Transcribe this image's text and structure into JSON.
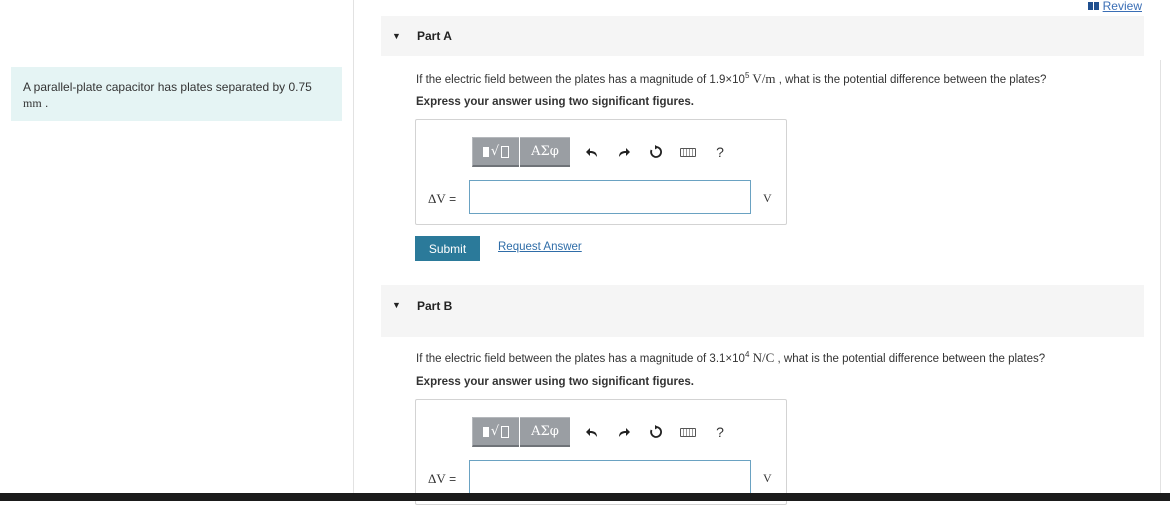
{
  "header": {
    "review_label": "Review"
  },
  "problem": {
    "text": "A parallel-plate capacitor has plates separated by 0.75",
    "unit": "mm",
    "suffix": " ."
  },
  "parts": [
    {
      "title": "Part A",
      "question_prefix": "If the electric field between the plates has a magnitude of 1.9×10",
      "exponent": "5",
      "field_unit": " V/m",
      "question_suffix": " , what is the potential difference between the plates?",
      "instructions": "Express your answer using two significant figures.",
      "toolbar": {
        "symbols_label": "ΑΣφ",
        "help_label": "?"
      },
      "input_label_symbol": "ΔV",
      "input_label_eq": " =",
      "input_value": "",
      "answer_unit": "V",
      "submit_label": "Submit",
      "request_label": "Request Answer"
    },
    {
      "title": "Part B",
      "question_prefix": "If the electric field between the plates has a magnitude of 3.1×10",
      "exponent": "4",
      "field_unit": " N/C",
      "question_suffix": " , what is the potential difference between the plates?",
      "instructions": "Express your answer using two significant figures.",
      "toolbar": {
        "symbols_label": "ΑΣφ",
        "help_label": "?"
      },
      "input_label_symbol": "ΔV",
      "input_label_eq": " =",
      "input_value": "",
      "answer_unit": "V"
    }
  ]
}
